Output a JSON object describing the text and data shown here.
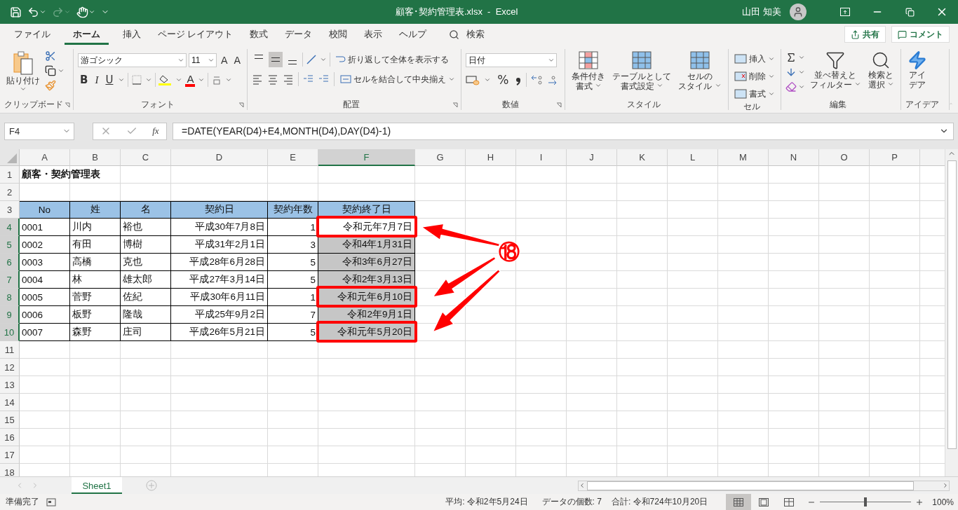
{
  "window": {
    "title": "顧客･契約管理表.xlsx  -  Excel",
    "user": "山田 知美"
  },
  "menu": [
    {
      "label": "ファイル",
      "selected": false
    },
    {
      "label": "ホーム",
      "selected": true
    },
    {
      "label": "挿入",
      "selected": false
    },
    {
      "label": "ページ レイアウト",
      "selected": false
    },
    {
      "label": "数式",
      "selected": false
    },
    {
      "label": "データ",
      "selected": false
    },
    {
      "label": "校閲",
      "selected": false
    },
    {
      "label": "表示",
      "selected": false
    },
    {
      "label": "ヘルプ",
      "selected": false
    }
  ],
  "search": {
    "label": "検索"
  },
  "share_buttons": [
    "共有",
    "コメント"
  ],
  "ribbon": [
    {
      "kind": "clipboard",
      "label": "クリップボード",
      "launcher": true,
      "paste": "貼り付け"
    },
    {
      "kind": "font",
      "label": "フォント",
      "launcher": true,
      "font": "游ゴシック",
      "size": "11",
      "grow": "A",
      "shrink": "A",
      "bold": "B",
      "italic": "I",
      "underline": "U",
      "font_color": "A"
    },
    {
      "kind": "alignment",
      "label": "配置",
      "launcher": true,
      "vertical_align": [
        {
          "selected": false
        },
        {
          "selected": true
        },
        {
          "selected": false
        }
      ],
      "wrap": "折り返して全体を表示する",
      "merge": "セルを結合して中央揃え"
    },
    {
      "kind": "number",
      "label": "数値",
      "launcher": true,
      "format": "日付",
      "percent": "%"
    },
    {
      "kind": "styles",
      "label": "スタイル",
      "items": [
        [
          "条件付き",
          "書式"
        ],
        [
          "テーブルとして",
          "書式設定"
        ],
        [
          "セルの",
          "スタイル"
        ]
      ]
    },
    {
      "kind": "cells",
      "label": "セル",
      "items": [
        "挿入",
        "削除",
        "書式"
      ]
    },
    {
      "kind": "editing",
      "label": "編集",
      "items": [
        [
          "並べ替えと",
          "フィルター"
        ],
        [
          "検索と",
          "選択"
        ]
      ]
    },
    {
      "kind": "ideas",
      "label": "アイデア",
      "button": [
        "アイ",
        "デア"
      ]
    }
  ],
  "formula_bar": {
    "name_box": "F4",
    "function_label": "fx",
    "formula": "=DATE(YEAR(D4)+E4,MONTH(D4),DAY(D4)-1)"
  },
  "columns": [
    {
      "label": "A",
      "selected": false
    },
    {
      "label": "B",
      "selected": false
    },
    {
      "label": "C",
      "selected": false
    },
    {
      "label": "D",
      "selected": false
    },
    {
      "label": "E",
      "selected": false
    },
    {
      "label": "F",
      "selected": true
    },
    {
      "label": "G",
      "selected": false
    },
    {
      "label": "H",
      "selected": false
    },
    {
      "label": "I",
      "selected": false
    },
    {
      "label": "J",
      "selected": false
    },
    {
      "label": "K",
      "selected": false
    },
    {
      "label": "L",
      "selected": false
    },
    {
      "label": "M",
      "selected": false
    },
    {
      "label": "N",
      "selected": false
    },
    {
      "label": "O",
      "selected": false
    },
    {
      "label": "P",
      "selected": false
    }
  ],
  "rows": [
    {
      "header": "1",
      "kind": "title",
      "cells": [
        "顧客・契約管理表"
      ]
    },
    {
      "header": "2",
      "kind": "blank"
    },
    {
      "header": "3",
      "kind": "header",
      "cells": [
        "No",
        "姓",
        "名",
        "契約日",
        "契約年数",
        "契約終了日"
      ]
    },
    {
      "header": "4",
      "kind": "data",
      "selected": true,
      "active": true,
      "highlighted": true,
      "cells": [
        "0001",
        "川内",
        "裕也",
        "平成30年7月8日",
        "1",
        "令和元年7月7日"
      ]
    },
    {
      "header": "5",
      "kind": "data",
      "selected": true,
      "active": false,
      "highlighted": false,
      "cells": [
        "0002",
        "有田",
        "博樹",
        "平成31年2月1日",
        "3",
        "令和4年1月31日"
      ]
    },
    {
      "header": "6",
      "kind": "data",
      "selected": true,
      "active": false,
      "highlighted": false,
      "cells": [
        "0003",
        "高橋",
        "克也",
        "平成28年6月28日",
        "5",
        "令和3年6月27日"
      ]
    },
    {
      "header": "7",
      "kind": "data",
      "selected": true,
      "active": false,
      "highlighted": false,
      "cells": [
        "0004",
        "林",
        "雄太郎",
        "平成27年3月14日",
        "5",
        "令和2年3月13日"
      ]
    },
    {
      "header": "8",
      "kind": "data",
      "selected": true,
      "active": false,
      "highlighted": true,
      "cells": [
        "0005",
        "菅野",
        "佐紀",
        "平成30年6月11日",
        "1",
        "令和元年6月10日"
      ]
    },
    {
      "header": "9",
      "kind": "data",
      "selected": true,
      "active": false,
      "highlighted": false,
      "cells": [
        "0006",
        "板野",
        "隆哉",
        "平成25年9月2日",
        "7",
        "令和2年9月1日"
      ]
    },
    {
      "header": "10",
      "kind": "data",
      "selected": true,
      "active": false,
      "highlighted": true,
      "cells": [
        "0007",
        "森野",
        "庄司",
        "平成26年5月21日",
        "5",
        "令和元年5月20日"
      ]
    },
    {
      "header": "11",
      "kind": "blank"
    },
    {
      "header": "12",
      "kind": "blank"
    },
    {
      "header": "13",
      "kind": "blank"
    },
    {
      "header": "14",
      "kind": "blank"
    },
    {
      "header": "15",
      "kind": "blank"
    },
    {
      "header": "16",
      "kind": "blank"
    },
    {
      "header": "17",
      "kind": "blank"
    },
    {
      "header": "18",
      "kind": "blank"
    }
  ],
  "annotation": {
    "label": "⑱"
  },
  "sheets": [
    {
      "label": "Sheet1",
      "selected": true
    }
  ],
  "status_bar": {
    "state": "準備完了",
    "average": "平均: 令和2年5月24日",
    "count": "データの個数: 7",
    "sum": "合計: 令和724年10月20日",
    "views": [
      {
        "selected": true
      },
      {
        "selected": false
      },
      {
        "selected": false
      }
    ],
    "zoom": "100%",
    "level": 0.5
  }
}
